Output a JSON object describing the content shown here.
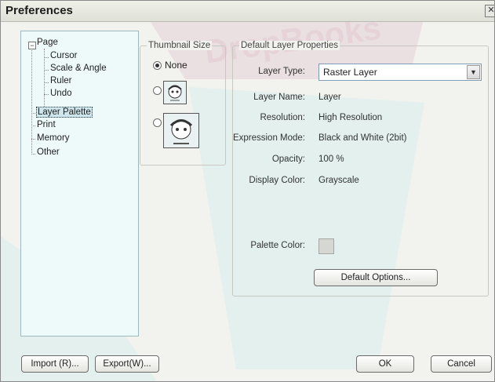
{
  "window": {
    "title": "Preferences"
  },
  "tree": {
    "page": "Page",
    "cursor": "Cursor",
    "scale_angle": "Scale & Angle",
    "ruler": "Ruler",
    "undo": "Undo",
    "layer_palette": "Layer Palette",
    "print": "Print",
    "memory": "Memory",
    "other": "Other"
  },
  "thumbnail": {
    "group_label": "Thumbnail Size",
    "none_label": "None",
    "selected": "None"
  },
  "defaults": {
    "group_label": "Default Layer Properties",
    "layer_type_label": "Layer Type:",
    "layer_type_value": "Raster Layer",
    "layer_name_label": "Layer Name:",
    "layer_name_value": "Layer",
    "resolution_label": "Resolution:",
    "resolution_value": "High Resolution",
    "expression_label": "Expression Mode:",
    "expression_value": "Black and White (2bit)",
    "opacity_label": "Opacity:",
    "opacity_value": "100 %",
    "display_color_label": "Display Color:",
    "display_color_value": "Grayscale",
    "palette_color_label": "Palette Color:",
    "default_options_button": "Default Options..."
  },
  "footer": {
    "import_button": "Import (R)...",
    "export_button": "Export(W)...",
    "ok_button": "OK",
    "cancel_button": "Cancel"
  },
  "colors": {
    "tree_bg": "#eef9fa",
    "watermark": "#d9c7cf",
    "dialog_bg": "#f2f3ee"
  },
  "watermark": {
    "text": "DropBooks"
  }
}
